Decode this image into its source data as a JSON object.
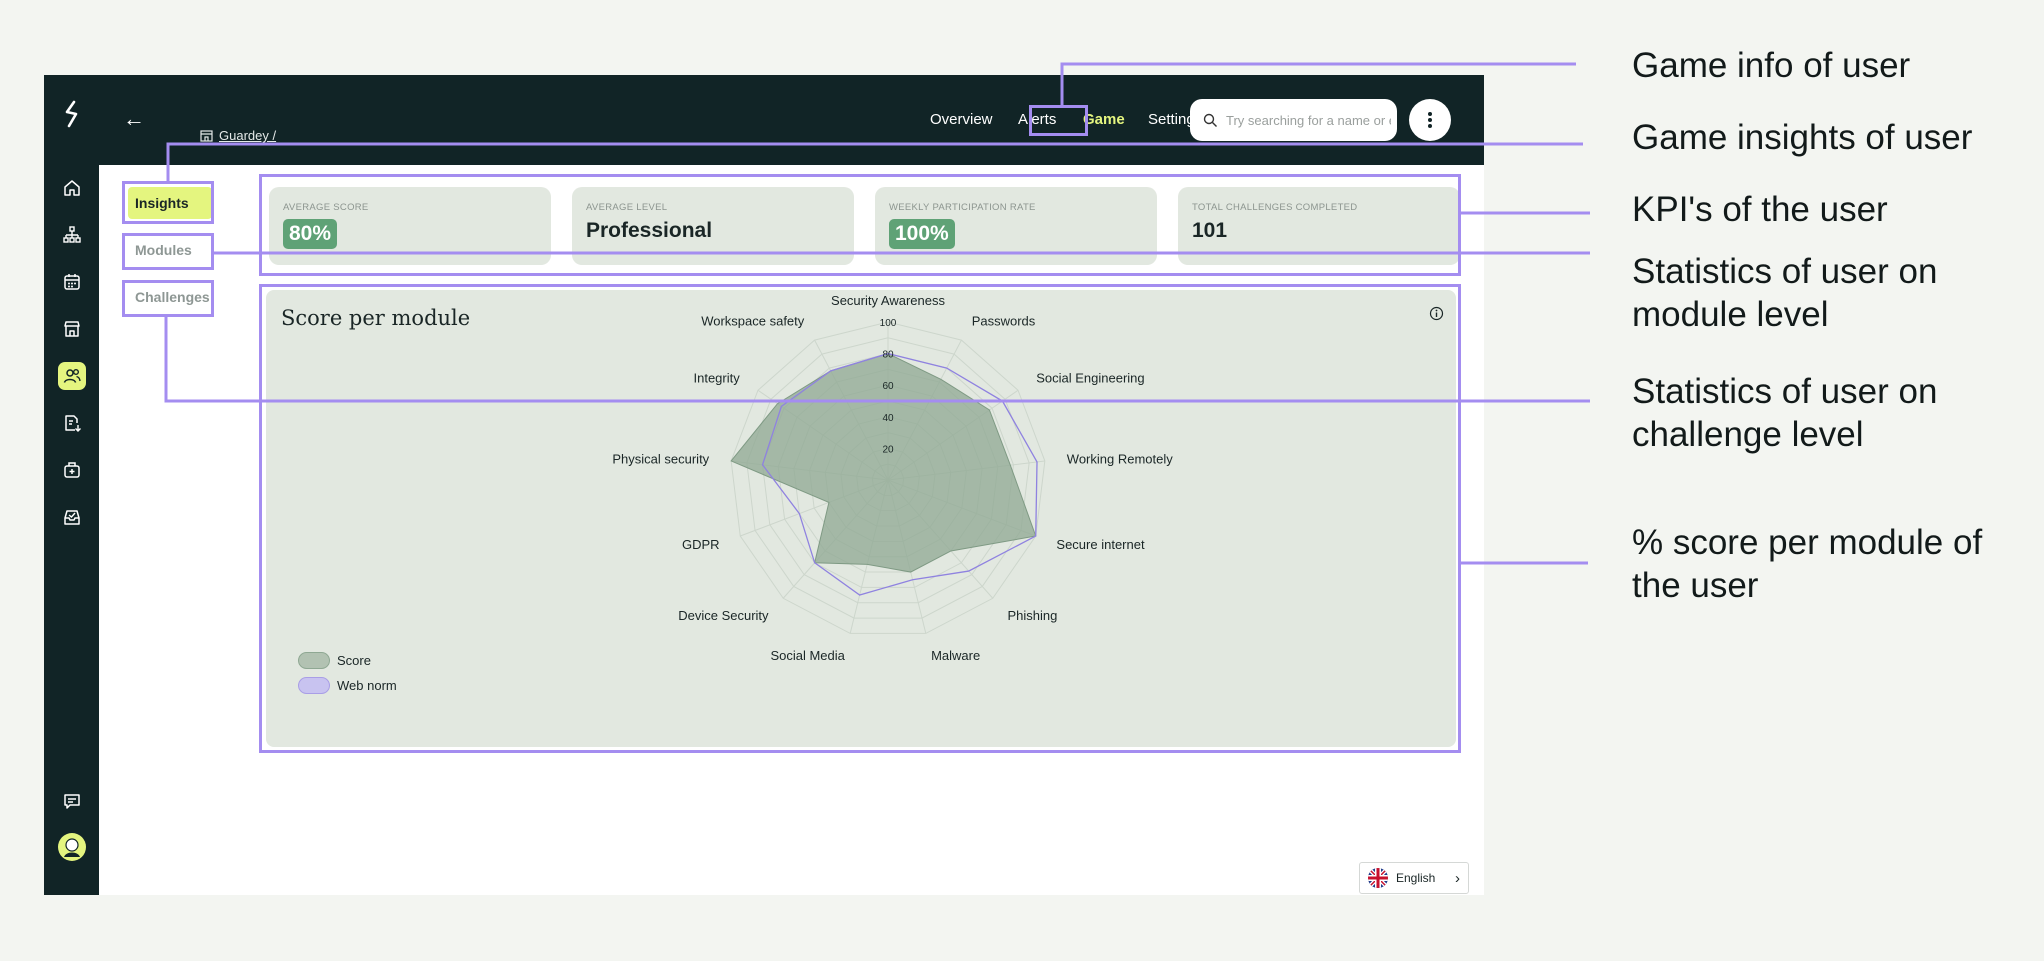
{
  "app": {
    "breadcrumb": "Guardey /",
    "nav": {
      "overview": "Overview",
      "alerts": "Alerts",
      "game": "Game",
      "settings": "Settings"
    },
    "search": {
      "placeholder": "Try searching for a name or e"
    },
    "language": "English"
  },
  "sidebar": {
    "icons": [
      "home-icon",
      "org-chart-icon",
      "calendar-icon",
      "store-icon",
      "users-icon",
      "document-download-icon",
      "first-aid-icon",
      "inbox-icon",
      "chat-icon",
      "avatar"
    ],
    "active": "users-icon"
  },
  "tabs": {
    "insights": "Insights",
    "modules": "Modules",
    "challenges": "Challenges",
    "active": "insights"
  },
  "kpis": [
    {
      "label": "AVERAGE SCORE",
      "value": "80%",
      "badge": true
    },
    {
      "label": "AVERAGE LEVEL",
      "value": "Professional",
      "badge": false
    },
    {
      "label": "WEEKLY PARTICIPATION RATE",
      "value": "100%",
      "badge": true
    },
    {
      "label": "TOTAL CHALLENGES COMPLETED",
      "value": "101",
      "badge": false
    }
  ],
  "chart_panel": {
    "title": "Score per module",
    "legend": {
      "score": "Score",
      "web_norm": "Web norm"
    }
  },
  "chart_data": {
    "type": "radar",
    "title": "Score per module",
    "categories": [
      "Security Awareness",
      "Passwords",
      "Social Engineering",
      "Working Remotely",
      "Secure internet",
      "Phishing",
      "Malware",
      "Social Media",
      "Device Security",
      "GDPR",
      "Physical security",
      "Integrity",
      "Workspace safety"
    ],
    "radial_ticks": [
      20,
      40,
      60,
      80,
      100
    ],
    "rlim": [
      0,
      100
    ],
    "series": [
      {
        "name": "Score",
        "values": [
          80,
          72,
          78,
          78,
          100,
          60,
          60,
          55,
          70,
          40,
          100,
          85,
          78
        ],
        "color": "#8fa893"
      },
      {
        "name": "Web norm",
        "values": [
          80,
          80,
          88,
          95,
          100,
          77,
          65,
          75,
          70,
          60,
          80,
          82,
          78
        ],
        "color": "#8f82e0"
      }
    ]
  },
  "annotations": [
    "Game info of user",
    "Game insights of user",
    "KPI's of the user",
    "Statistics of user on module level",
    "Statistics of user on challenge level",
    "% score per module of the user"
  ],
  "colors": {
    "dark": "#112426",
    "accent": "#e4f57f",
    "badge": "#5fa276",
    "highlight": "#a48df0",
    "panel": "#e2e8e0"
  }
}
